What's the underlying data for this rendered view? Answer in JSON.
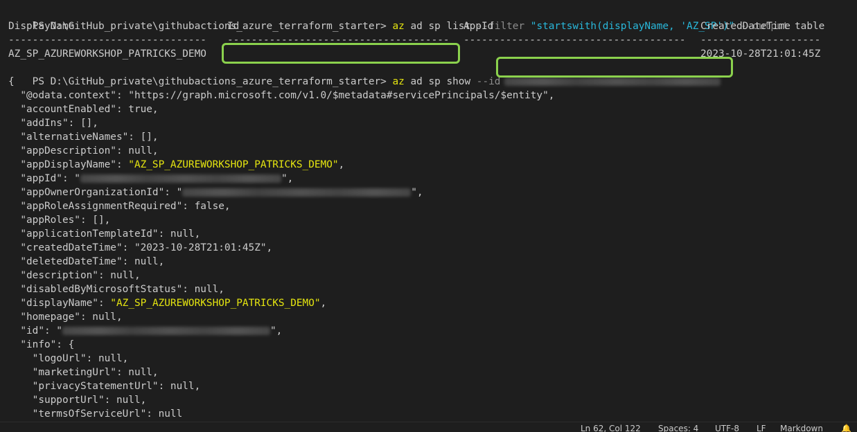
{
  "prompt": "PS D:\\GitHub_private\\githubactions_azure_terraform_starter> ",
  "cmd1": {
    "exe": "az",
    "args": " ad sp list ",
    "flag1": "--filter",
    "filter_value": "\"startswith(displayName, 'AZ_SP')\"",
    "flag2": "--output",
    "output_value": "table"
  },
  "table": {
    "headers": [
      "DisplayName",
      "Id",
      "AppId",
      "CreatedDateTime"
    ],
    "separators": [
      "---------------------------------",
      "-------------------------------------",
      "-------------------------------------",
      "--------------------"
    ],
    "row": {
      "display_name": "AZ_SP_AZUREWORKSHOP_PATRICKS_DEMO",
      "created": "2023-10-28T21:01:45Z"
    }
  },
  "cmd2": {
    "exe": "az",
    "args": " ad sp show ",
    "flag": "--id"
  },
  "json_lines": [
    {
      "t": "{"
    },
    {
      "t": "  \"@odata.context\": \"https://graph.microsoft.com/v1.0/$metadata#servicePrincipals/$entity\","
    },
    {
      "t": "  \"accountEnabled\": true,"
    },
    {
      "t": "  \"addIns\": [],"
    },
    {
      "t": "  \"alternativeNames\": [],"
    },
    {
      "t": "  \"appDescription\": null,"
    },
    {
      "t": "  \"appDisplayName\": ",
      "y": "\"AZ_SP_AZUREWORKSHOP_PATRICKS_DEMO\"",
      "a": ","
    },
    {
      "t": "  \"appId\": \"",
      "b": 290,
      "a": "\","
    },
    {
      "t": "  \"appOwnerOrganizationId\": \"",
      "b": 330,
      "a": "\","
    },
    {
      "t": "  \"appRoleAssignmentRequired\": false,"
    },
    {
      "t": "  \"appRoles\": [],"
    },
    {
      "t": "  \"applicationTemplateId\": null,"
    },
    {
      "t": "  \"createdDateTime\": \"2023-10-28T21:01:45Z\","
    },
    {
      "t": "  \"deletedDateTime\": null,"
    },
    {
      "t": "  \"description\": null,"
    },
    {
      "t": "  \"disabledByMicrosoftStatus\": null,"
    },
    {
      "t": "  \"displayName\": ",
      "y": "\"AZ_SP_AZUREWORKSHOP_PATRICKS_DEMO\"",
      "a": ","
    },
    {
      "t": "  \"homepage\": null,"
    },
    {
      "t": "  \"id\": \"",
      "b": 300,
      "a": "\","
    },
    {
      "t": "  \"info\": {"
    },
    {
      "t": "    \"logoUrl\": null,"
    },
    {
      "t": "    \"marketingUrl\": null,"
    },
    {
      "t": "    \"privacyStatementUrl\": null,"
    },
    {
      "t": "    \"supportUrl\": null,"
    },
    {
      "t": "    \"termsOfServiceUrl\": null"
    }
  ],
  "statusbar": {
    "position": "Ln 62, Col 122",
    "spaces": "Spaces: 4",
    "encoding": "UTF-8",
    "eol": "LF",
    "language": "Markdown"
  },
  "colors": {
    "background": "#1e1e1e",
    "text": "#cccccc",
    "command": "#e5e510",
    "parameter": "#8c8c8c",
    "string": "#29b8db",
    "highlight": "#8bd14d"
  }
}
